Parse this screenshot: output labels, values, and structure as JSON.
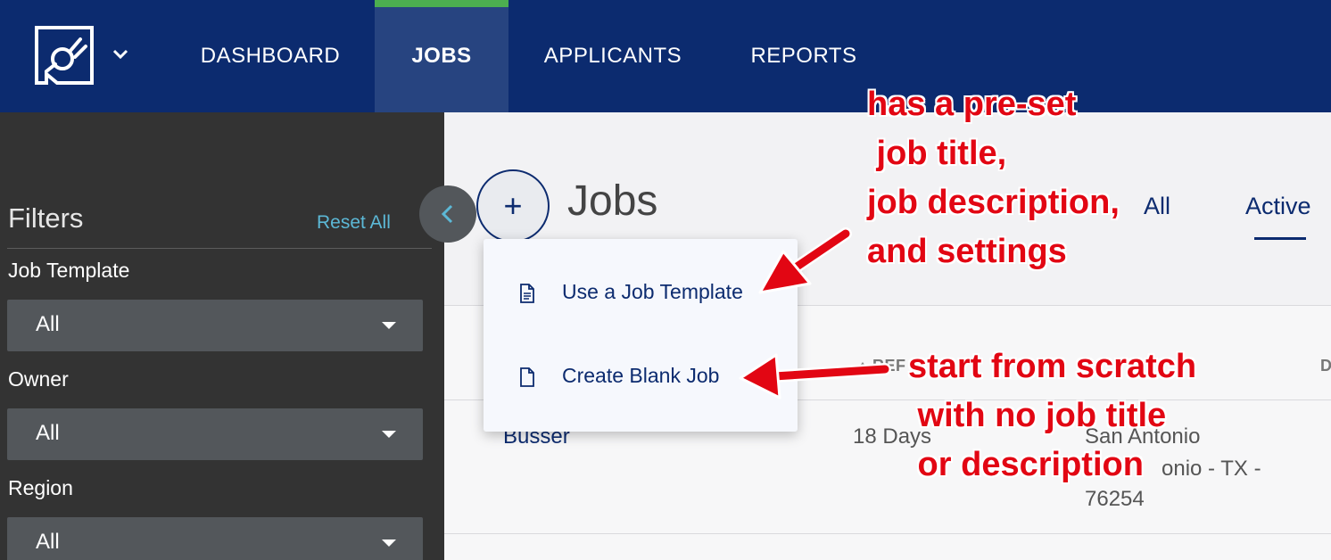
{
  "nav": {
    "items": [
      {
        "label": "DASHBOARD",
        "active": false
      },
      {
        "label": "JOBS",
        "active": true
      },
      {
        "label": "APPLICANTS",
        "active": false
      },
      {
        "label": "REPORTS",
        "active": false
      }
    ],
    "accent_color": "#4caf50",
    "bg_color": "#0c2b6f",
    "logo_icon": "broken-plug-logo-icon",
    "menu_icon": "chevron-down-icon"
  },
  "sidebar": {
    "title": "Filters",
    "reset_label": "Reset All",
    "filters": [
      {
        "label": "Job Template",
        "value": "All"
      },
      {
        "label": "Owner",
        "value": "All"
      },
      {
        "label": "Region",
        "value": "All"
      }
    ],
    "collapse_icon": "chevron-left-icon"
  },
  "main": {
    "add_label": "+",
    "title": "Jobs",
    "tabs": [
      {
        "label": "All",
        "active": false
      },
      {
        "label": "Active",
        "active": true
      }
    ],
    "table": {
      "headers": [
        "REF",
        "D"
      ],
      "rows": [
        {
          "title": "Busser",
          "age": "18 Days",
          "location_line1": "San Antonio",
          "location_line2": "onio - TX -",
          "location_line3": "76254"
        }
      ]
    }
  },
  "menu": {
    "items": [
      {
        "label": "Use a Job Template",
        "icon": "document-lines-icon"
      },
      {
        "label": "Create Blank Job",
        "icon": "document-blank-icon"
      }
    ]
  },
  "annotations": {
    "template_note": "has a pre-set\n job title,\njob description,\nand settings",
    "blank_note": "start from scratch\n with no job title\n or description",
    "color": "#e20613"
  }
}
